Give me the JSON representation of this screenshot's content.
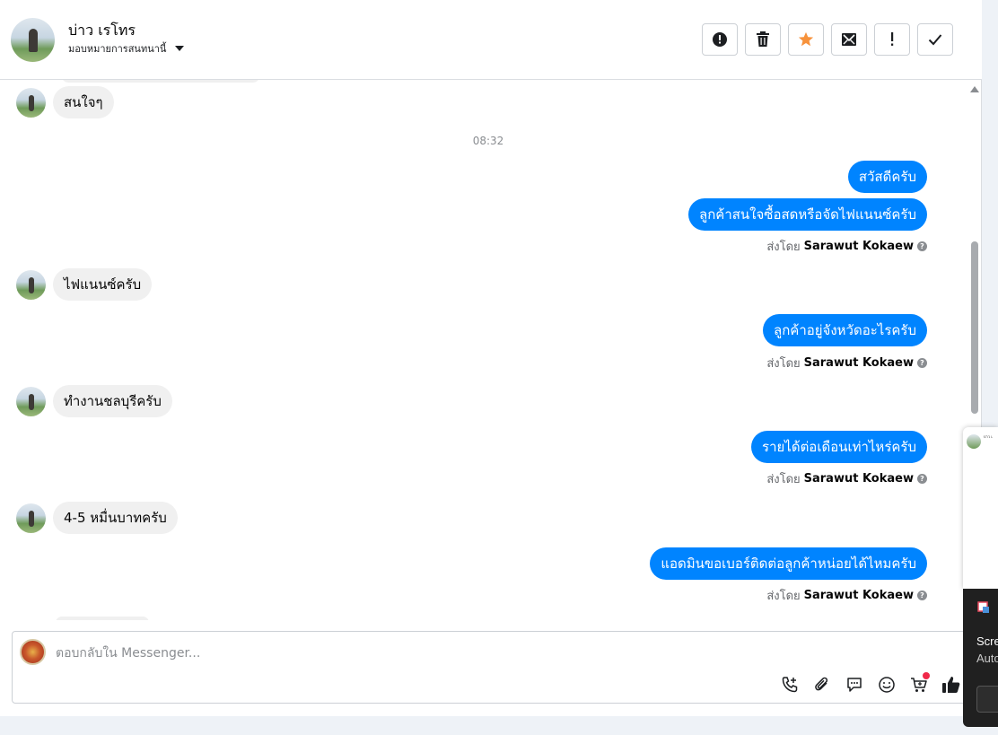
{
  "header": {
    "name": "บ่าว เรโทร",
    "assign_label": "มอบหมายการสนทนานี้"
  },
  "actions": [
    {
      "name": "report-button",
      "icon": "exclamation-circle-icon"
    },
    {
      "name": "delete-button",
      "icon": "trash-icon"
    },
    {
      "name": "star-button",
      "icon": "star-icon"
    },
    {
      "name": "mark-unread-button",
      "icon": "mail-icon"
    },
    {
      "name": "spam-button",
      "icon": "exclamation-icon"
    },
    {
      "name": "done-button",
      "icon": "check-icon"
    }
  ],
  "colors": {
    "accent": "#0084ff",
    "star": "#f7923b",
    "badge": "#f02849"
  },
  "thread": {
    "msg1": "สนใจๆ",
    "time": "08:32",
    "out1": "สวัสดีครับ",
    "out2": "ลูกค้าสนใจซื้อสดหรือจัดไฟแนนซ์ครับ",
    "sent_prefix": "ส่งโดย",
    "sender": "Sarawut Kokaew",
    "msg2": "ไฟแนนซ์ครับ",
    "out3": "ลูกค้าอยู่จังหวัดอะไรครับ",
    "msg3": "ทำงานชลบุรีครับ",
    "out4": "รายได้ต่อเดือนเท่าไหร่ครับ",
    "msg4": "4-5 หมื่นบาทครับ",
    "out5": "แอดมินขอเบอร์ติดต่อลูกค้าหน่อยได้ไหมครับ"
  },
  "composer": {
    "placeholder": "ตอบกลับใน Messenger..."
  },
  "overlay": {
    "mini_text": "บ่าว เ",
    "toast_title": "Scre",
    "toast_sub": "Auto"
  }
}
